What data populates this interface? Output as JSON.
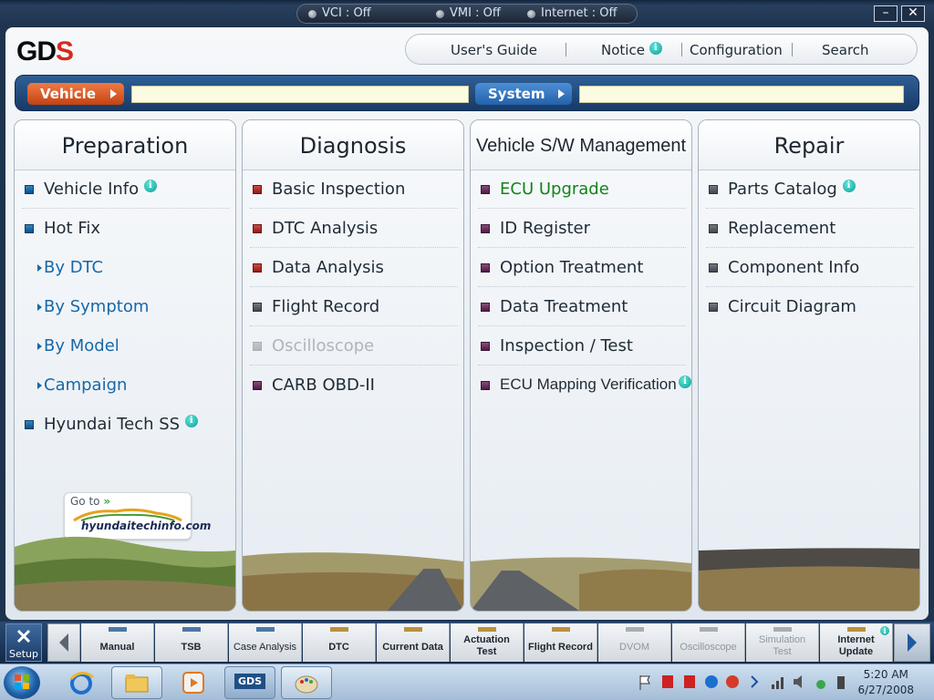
{
  "status": {
    "vci": "VCI : Off",
    "vmi": "VMI : Off",
    "internet": "Internet : Off"
  },
  "window_controls": {
    "minimize": "–",
    "close": "✕"
  },
  "logo": {
    "text1": "GD",
    "text2": "S"
  },
  "top_nav": {
    "users_guide": "User's Guide",
    "notice": "Notice",
    "configuration": "Configuration",
    "search": "Search"
  },
  "selector": {
    "vehicle_label": "Vehicle",
    "vehicle_value": "",
    "system_label": "System",
    "system_value": ""
  },
  "columns": {
    "preparation": {
      "title": "Preparation",
      "items": [
        "Vehicle Info",
        "Hot Fix",
        "By DTC",
        "By Symptom",
        "By Model",
        "Campaign",
        "Hyundai Tech SS"
      ]
    },
    "diagnosis": {
      "title": "Diagnosis",
      "items": [
        "Basic Inspection",
        "DTC Analysis",
        "Data Analysis",
        "Flight Record",
        "Oscilloscope",
        "CARB OBD-II"
      ]
    },
    "vehicle_sw": {
      "title": "Vehicle S/W Management",
      "items": [
        "ECU Upgrade",
        "ID Register",
        "Option Treatment",
        "Data Treatment",
        "Inspection / Test",
        "ECU Mapping Verification"
      ]
    },
    "repair": {
      "title": "Repair",
      "items": [
        "Parts Catalog",
        "Replacement",
        "Component Info",
        "Circuit Diagram"
      ]
    }
  },
  "goto_banner": {
    "label": "Go to",
    "site": "hyundaitechinfo.com"
  },
  "toolbar": {
    "setup": "Setup",
    "buttons": [
      {
        "line1": "Manual",
        "line2": ""
      },
      {
        "line1": "TSB",
        "line2": ""
      },
      {
        "line1": "Case Analysis",
        "line2": ""
      },
      {
        "line1": "DTC",
        "line2": ""
      },
      {
        "line1": "Current Data",
        "line2": ""
      },
      {
        "line1": "Actuation",
        "line2": "Test"
      },
      {
        "line1": "Flight Record",
        "line2": ""
      },
      {
        "line1": "DVOM",
        "line2": ""
      },
      {
        "line1": "Oscilloscope",
        "line2": ""
      },
      {
        "line1": "Simulation",
        "line2": "Test"
      },
      {
        "line1": "Internet",
        "line2": "Update"
      }
    ]
  },
  "taskbar": {
    "gds_label": "GDS",
    "time": "5:20 AM",
    "date": "6/27/2008"
  },
  "colors": {
    "accent_blue": "#1868a8",
    "vehicle_orange": "#c44312",
    "system_blue": "#2461a9",
    "ecu_green": "#15811b",
    "info_teal": "#0f9c95"
  }
}
